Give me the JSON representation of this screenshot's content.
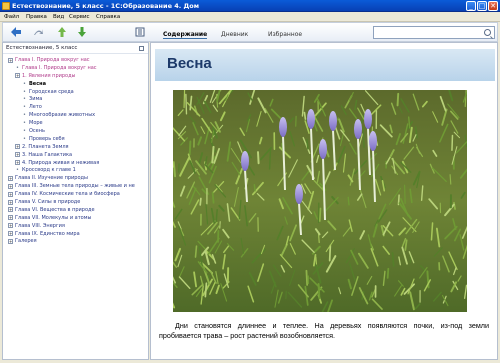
{
  "window": {
    "title": "Естествознание, 5 класс - 1С:Образование 4. Дом",
    "minimize": "_",
    "maximize": "□",
    "close": "✕"
  },
  "menu": {
    "items": [
      "Файл",
      "Правка",
      "Вид",
      "Сервис",
      "Справка"
    ]
  },
  "toolbar": {
    "icons": [
      "back-icon",
      "forward-icon",
      "up-icon",
      "download-icon",
      "toc-icon"
    ],
    "tabs": [
      {
        "label": "Содержание",
        "active": true
      },
      {
        "label": "Дневник",
        "active": false
      },
      {
        "label": "Избранное",
        "active": false
      }
    ],
    "search_placeholder": ""
  },
  "sidebar": {
    "header": "Естествознание, 5 класс",
    "tree": [
      {
        "label": "Глава I. Природа вокруг нас",
        "level": 0,
        "node": "box",
        "style": "pink"
      },
      {
        "label": "Глава I. Природа вокруг нас",
        "level": 1,
        "node": "dot",
        "style": "pink"
      },
      {
        "label": "1. Явления природы",
        "level": 1,
        "node": "box",
        "style": "pink"
      },
      {
        "label": "Весна",
        "level": 2,
        "node": "dot",
        "style": "current"
      },
      {
        "label": "Городская среда",
        "level": 2,
        "node": "dot",
        "style": ""
      },
      {
        "label": "Зима",
        "level": 2,
        "node": "dot",
        "style": ""
      },
      {
        "label": "Лето",
        "level": 2,
        "node": "dot",
        "style": ""
      },
      {
        "label": "Многообразие животных",
        "level": 2,
        "node": "dot",
        "style": ""
      },
      {
        "label": "Море",
        "level": 2,
        "node": "dot",
        "style": ""
      },
      {
        "label": "Осень",
        "level": 2,
        "node": "dot",
        "style": ""
      },
      {
        "label": "Проверь себя",
        "level": 2,
        "node": "dot",
        "style": ""
      },
      {
        "label": "2. Планета Земля",
        "level": 1,
        "node": "box",
        "style": ""
      },
      {
        "label": "3. Наша Галактика",
        "level": 1,
        "node": "box",
        "style": ""
      },
      {
        "label": "4. Природа живая и неживая",
        "level": 1,
        "node": "box",
        "style": ""
      },
      {
        "label": "Кроссворд к главе 1",
        "level": 1,
        "node": "dot",
        "style": ""
      },
      {
        "label": "Глава II. Изучение природы",
        "level": 0,
        "node": "box",
        "style": ""
      },
      {
        "label": "Глава III. Земные тела природы – живые и не",
        "level": 0,
        "node": "box",
        "style": ""
      },
      {
        "label": "Глава IV. Космические тела и биосфера",
        "level": 0,
        "node": "box",
        "style": ""
      },
      {
        "label": "Глава V. Силы в природе",
        "level": 0,
        "node": "box",
        "style": ""
      },
      {
        "label": "Глава VI. Вещества в природе",
        "level": 0,
        "node": "box",
        "style": ""
      },
      {
        "label": "Глава VII. Молекулы и атомы",
        "level": 0,
        "node": "box",
        "style": ""
      },
      {
        "label": "Глава VIII. Энергия",
        "level": 0,
        "node": "box",
        "style": ""
      },
      {
        "label": "Глава IX. Единство мира",
        "level": 0,
        "node": "box",
        "style": ""
      },
      {
        "label": "Галерея",
        "level": 0,
        "node": "box",
        "style": ""
      }
    ]
  },
  "content": {
    "heading": "Весна",
    "caption": "Дни становятся длиннее и теплее. На деревьях появляются почки, из-под земли пробивается трава – рост растений возобновляется."
  },
  "colors": {
    "titlebar": "#0a5bd8",
    "heading_band": "#c9def0",
    "heading_text": "#1d3a6a",
    "tree_link": "#2a3a88",
    "tree_pink": "#b03a8a"
  }
}
